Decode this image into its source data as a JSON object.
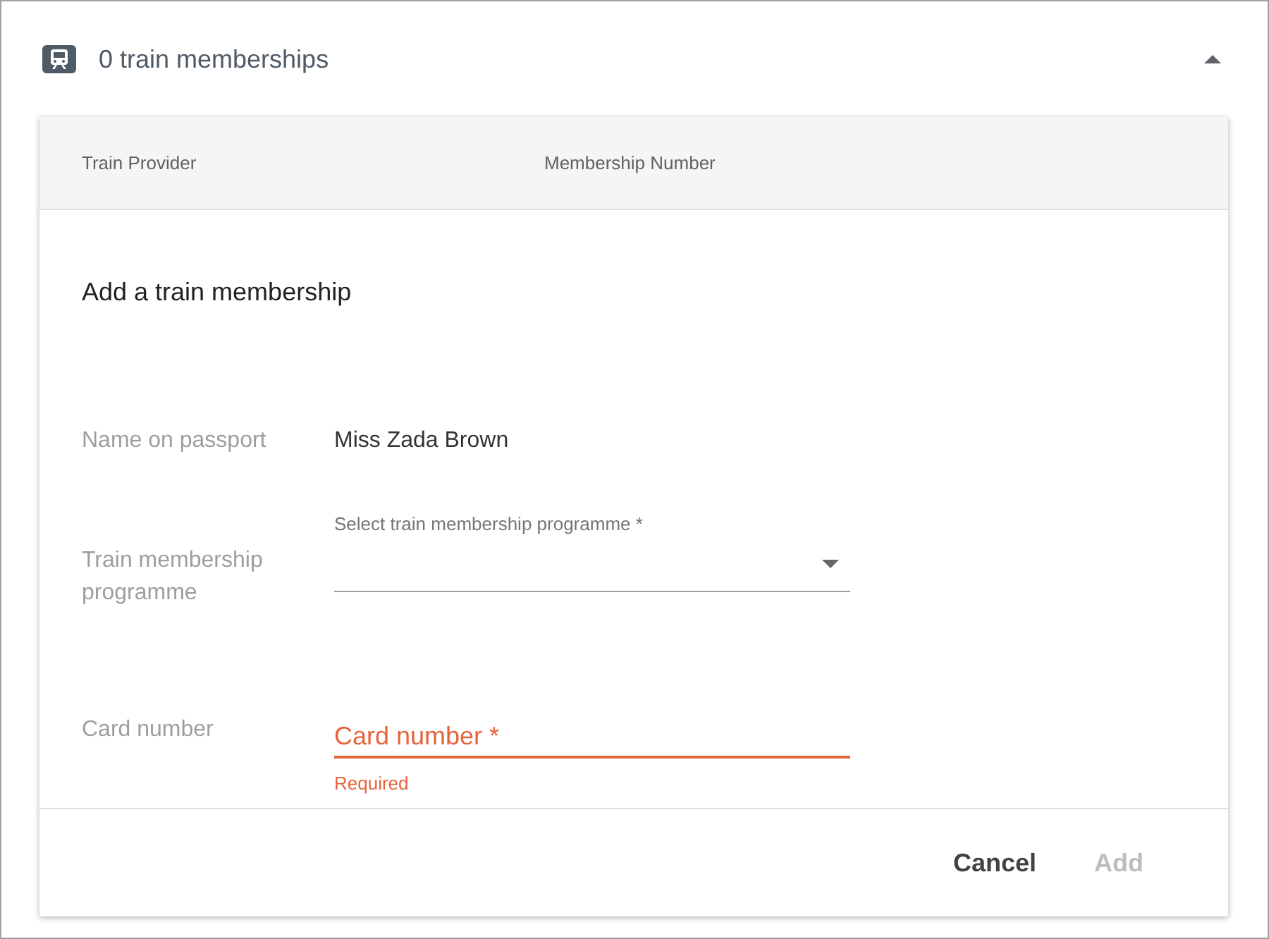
{
  "section": {
    "title": "0 train memberships",
    "expanded": true
  },
  "table": {
    "columns": [
      "Train Provider",
      "Membership Number"
    ]
  },
  "form": {
    "title": "Add a train membership",
    "fields": [
      {
        "kind": "text",
        "label": "Name on passport",
        "value": "Miss Zada Brown"
      },
      {
        "kind": "select",
        "label": "Train membership programme",
        "field_label": "Select train membership programme *"
      },
      {
        "kind": "input",
        "label": "Card number",
        "placeholder": "Card number *",
        "invalid": true,
        "error": "Required"
      }
    ]
  },
  "buttons": [
    {
      "label": "Cancel",
      "disabled": false
    },
    {
      "label": "Add",
      "disabled": true
    }
  ]
}
